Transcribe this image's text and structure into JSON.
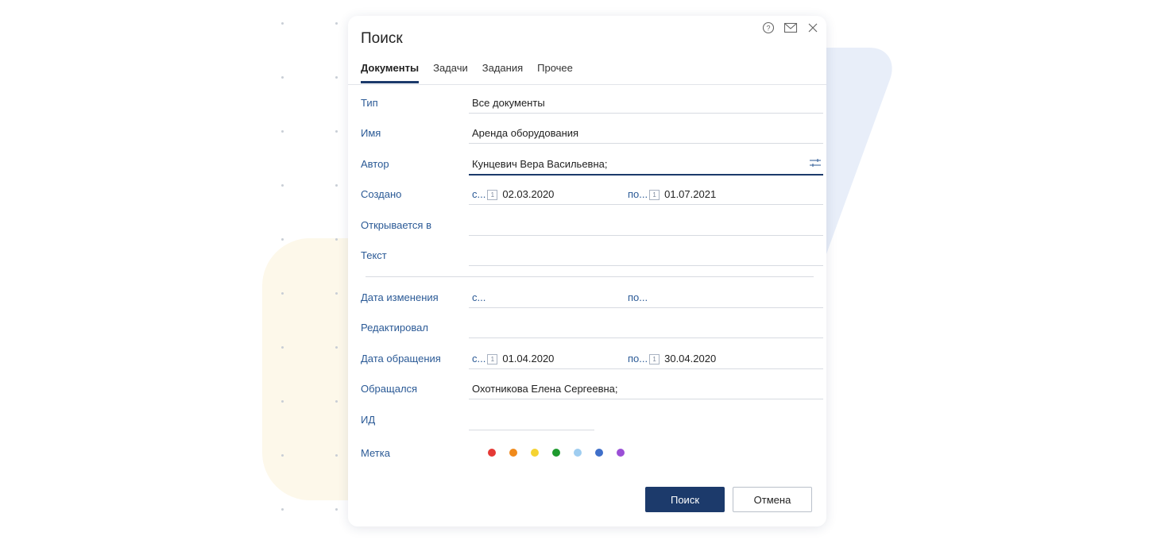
{
  "dialog": {
    "title": "Поиск",
    "icons": [
      "help-icon",
      "mail-icon",
      "close-icon"
    ]
  },
  "tabs": [
    {
      "label": "Документы",
      "active": true
    },
    {
      "label": "Задачи",
      "active": false
    },
    {
      "label": "Задания",
      "active": false
    },
    {
      "label": "Прочее",
      "active": false
    }
  ],
  "fields": {
    "type": {
      "label": "Тип",
      "value": "Все документы"
    },
    "name": {
      "label": "Имя",
      "value": "Аренда оборудования"
    },
    "author": {
      "label": "Автор",
      "value": "Кунцевич Вера Васильевна;"
    },
    "created": {
      "label": "Создано",
      "from_prefix": "с...",
      "from": "02.03.2020",
      "to_prefix": "по...",
      "to": "01.07.2021"
    },
    "opens_in": {
      "label": "Открывается в",
      "value": ""
    },
    "text": {
      "label": "Текст",
      "value": ""
    },
    "modified": {
      "label": "Дата изменения",
      "from_prefix": "с...",
      "to_prefix": "по..."
    },
    "edited_by": {
      "label": "Редактировал",
      "value": ""
    },
    "accessed": {
      "label": "Дата обращения",
      "from_prefix": "с...",
      "from": "01.04.2020",
      "to_prefix": "по...",
      "to": "30.04.2020"
    },
    "accessed_by": {
      "label": "Обращался",
      "value": "Охотникова Елена Сергеевна;"
    },
    "id": {
      "label": "ИД",
      "value": ""
    },
    "tag": {
      "label": "Метка",
      "colors": [
        "#e53935",
        "#f08a1c",
        "#f5d332",
        "#1e9a2e",
        "#9fcdf0",
        "#3f6fc9",
        "#9b4fd6"
      ]
    }
  },
  "calendar_glyph": "1",
  "buttons": {
    "search": "Поиск",
    "cancel": "Отмена"
  },
  "colors": {
    "accent": "#1c3a6b",
    "label": "#2b5a96"
  }
}
